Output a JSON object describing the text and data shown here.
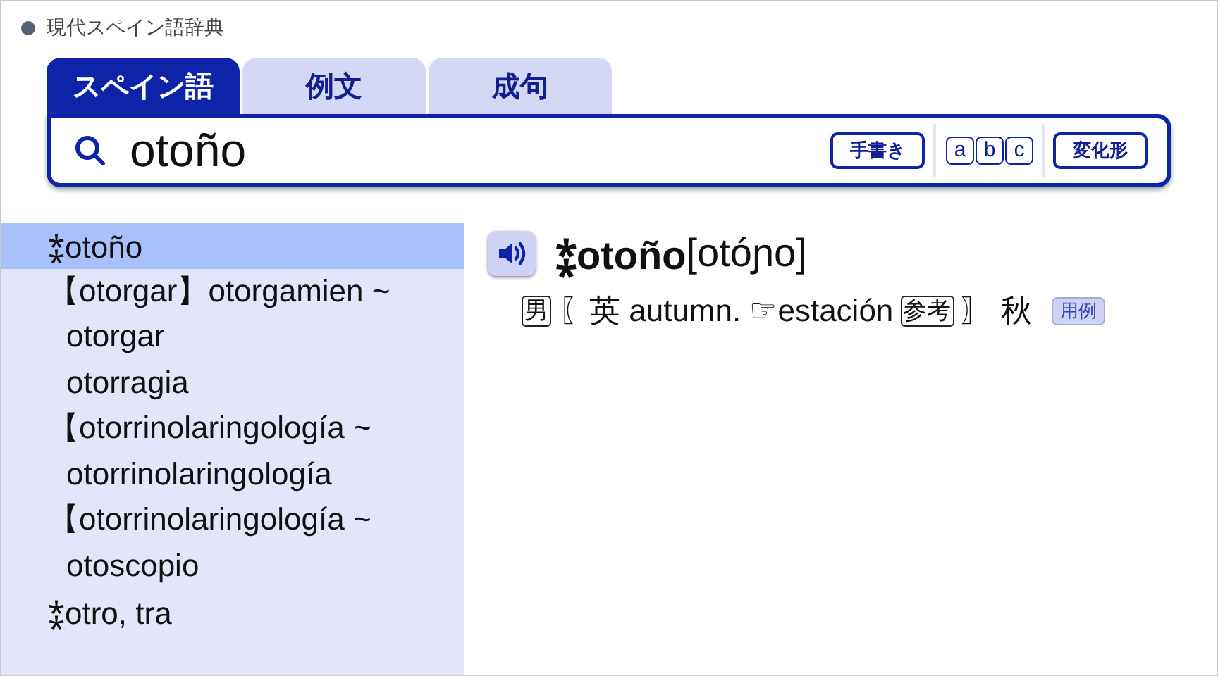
{
  "app_title": "現代スペイン語辞典",
  "tabs": [
    {
      "label": "スペイン語",
      "selected": true
    },
    {
      "label": "例文",
      "selected": false
    },
    {
      "label": "成句",
      "selected": false
    }
  ],
  "search": {
    "value": "otoño",
    "buttons": [
      {
        "kind": "wide",
        "label": "手書き"
      },
      {
        "kind": "letters",
        "letters": [
          "a",
          "b",
          "c"
        ]
      },
      {
        "kind": "wide",
        "label": "変化形"
      }
    ]
  },
  "results": [
    {
      "label": "⁑otoño",
      "selected": true
    },
    {
      "label": "【otorgar】otorgamien ~",
      "selected": false
    },
    {
      "label": "otorgar",
      "selected": false,
      "indented": true
    },
    {
      "label": "otorragia",
      "selected": false,
      "indented": true
    },
    {
      "label": "【otorrinolaringología ~",
      "selected": false
    },
    {
      "label": "otorrinolaringología",
      "selected": false,
      "indented": true
    },
    {
      "label": "【otorrinolaringología ~",
      "selected": false
    },
    {
      "label": "otoscopio",
      "selected": false,
      "indented": true
    },
    {
      "label": "⁑otro, tra",
      "selected": false
    }
  ],
  "entry": {
    "headword": "⁑otoño",
    "pronunciation": "[otóɲo]",
    "definition": [
      {
        "kind": "tag",
        "text": "男"
      },
      {
        "kind": "text",
        "text": "〖英 autumn. ☞estación"
      },
      {
        "kind": "tag",
        "text": "参考"
      },
      {
        "kind": "text",
        "text": "〗 秋"
      },
      {
        "kind": "button",
        "text": "用例"
      }
    ]
  }
}
